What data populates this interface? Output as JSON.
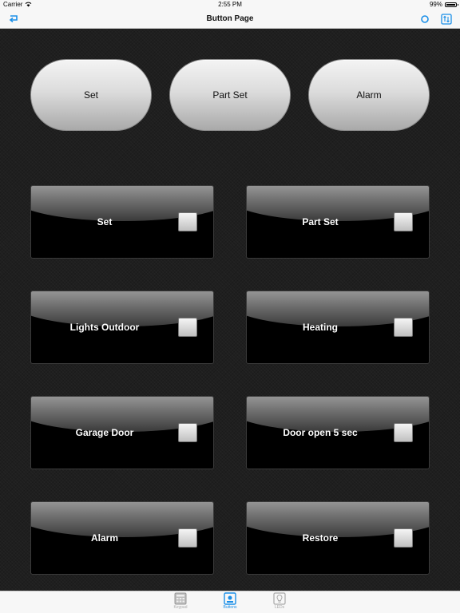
{
  "status_bar": {
    "carrier": "Carrier",
    "time": "2:55 PM",
    "battery": "99%"
  },
  "nav_bar": {
    "title": "Button Page",
    "back_icon": "return-arrow-icon",
    "right_icons": [
      "circle-icon",
      "swap-arrows-icon"
    ],
    "accent_color": "#1a8fe8"
  },
  "pill_buttons": [
    {
      "label": "Set"
    },
    {
      "label": "Part Set"
    },
    {
      "label": "Alarm"
    }
  ],
  "tiles": [
    {
      "label": "Set"
    },
    {
      "label": "Part Set"
    },
    {
      "label": "Lights Outdoor"
    },
    {
      "label": "Heating"
    },
    {
      "label": "Garage Door"
    },
    {
      "label": "Door open 5 sec"
    },
    {
      "label": "Alarm"
    },
    {
      "label": "Restore"
    }
  ],
  "tab_bar": {
    "tabs": [
      {
        "label": "Keypad",
        "icon": "keypad-icon",
        "active": false
      },
      {
        "label": "Buttons",
        "icon": "buttons-icon",
        "active": true
      },
      {
        "label": "LEDs",
        "icon": "led-icon",
        "active": false
      }
    ],
    "active_color": "#1a8fe8",
    "inactive_color": "#a9a9a9"
  }
}
